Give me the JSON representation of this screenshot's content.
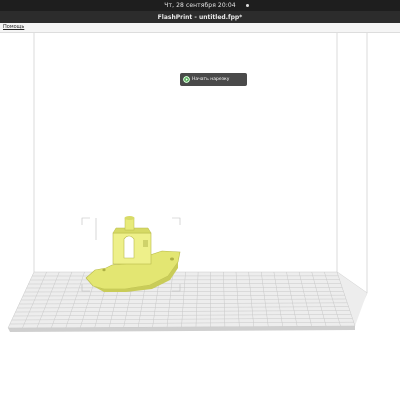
{
  "system_bar": {
    "clock": "Чт, 28 сентября  20:04"
  },
  "window": {
    "title": "FlashPrint - untitled.fpp*"
  },
  "menu": {
    "items": [
      {
        "label": "Помощь"
      }
    ]
  },
  "toolbar": {
    "slice_label": "Начать нарезку"
  },
  "colors": {
    "model": "#e8ec7e",
    "platform": "#d9d9d9",
    "button": "#4a4a4a",
    "button_icon": "#4caf50"
  },
  "icons": {
    "slice": "play-circle-icon",
    "status": "dot-icon"
  }
}
